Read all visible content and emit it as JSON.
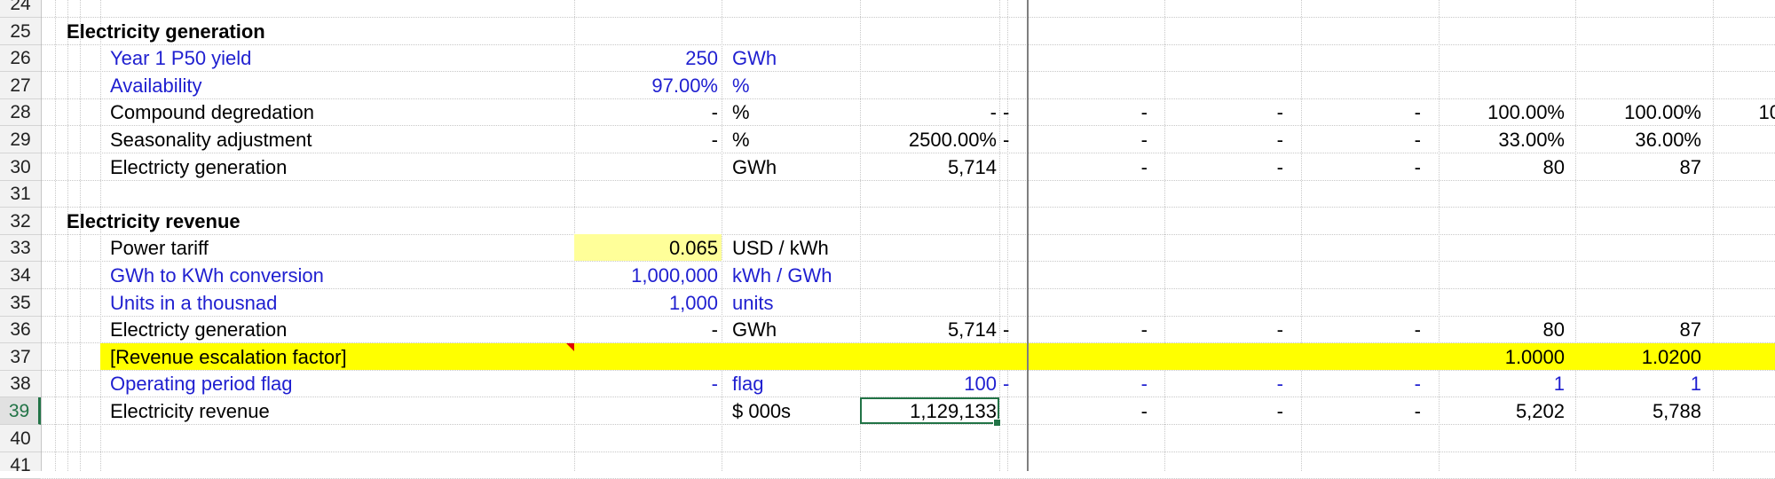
{
  "rows": [
    {
      "num": "24"
    },
    {
      "num": "25",
      "section": "Electricity generation"
    },
    {
      "num": "26",
      "label": "Year 1 P50 yield",
      "blue": true,
      "input": "250",
      "unit": "GWh",
      "total": "",
      "flag": "",
      "cols": [
        "",
        "",
        "",
        "",
        "",
        "",
        ""
      ]
    },
    {
      "num": "27",
      "label": "Availability",
      "blue": true,
      "input": "97.00%",
      "unit": "%",
      "total": "",
      "flag": "",
      "cols": [
        "",
        "",
        "",
        "",
        "",
        "",
        ""
      ]
    },
    {
      "num": "28",
      "label": "Compound degredation",
      "blue": false,
      "input": "-",
      "unit": "%",
      "total": "-",
      "flag": "-",
      "cols": [
        "-",
        "-",
        "-",
        "100.00%",
        "100.00%",
        "10"
      ]
    },
    {
      "num": "29",
      "label": "Seasonality adjustment",
      "blue": false,
      "input": "-",
      "unit": "%",
      "total": "2500.00%",
      "flag": "-",
      "cols": [
        "-",
        "-",
        "-",
        "33.00%",
        "36.00%",
        ""
      ]
    },
    {
      "num": "30",
      "label": "Electricty generation",
      "blue": false,
      "input": "",
      "unit": "GWh",
      "total": "5,714",
      "flag": "",
      "cols": [
        "-",
        "-",
        "-",
        "80",
        "87",
        ""
      ]
    },
    {
      "num": "31"
    },
    {
      "num": "32",
      "section": "Electricity revenue"
    },
    {
      "num": "33",
      "label": "Power tariff",
      "blue": false,
      "input": "0.065",
      "unit": "USD / kWh",
      "total": "",
      "flag": "",
      "cols": [
        "",
        "",
        "",
        "",
        "",
        ""
      ]
    },
    {
      "num": "34",
      "label": "GWh to KWh conversion",
      "blue": true,
      "input": "1,000,000",
      "unit": "kWh / GWh",
      "total": "",
      "flag": "",
      "cols": [
        "",
        "",
        "",
        "",
        "",
        ""
      ]
    },
    {
      "num": "35",
      "label": "Units in a thousnad",
      "blue": true,
      "input": "1,000",
      "unit": "units",
      "total": "",
      "flag": "",
      "cols": [
        "",
        "",
        "",
        "",
        "",
        ""
      ]
    },
    {
      "num": "36",
      "label": "Electricty generation",
      "blue": false,
      "input": "-",
      "unit": "GWh",
      "total": "5,714",
      "flag": "-",
      "cols": [
        "-",
        "-",
        "-",
        "80",
        "87",
        ""
      ]
    },
    {
      "num": "37",
      "label": "[Revenue escalation factor]",
      "blue": false,
      "input": "",
      "unit": "",
      "total": "",
      "flag": "",
      "cols": [
        "",
        "",
        "",
        "1.0000",
        "1.0200",
        ""
      ]
    },
    {
      "num": "38",
      "label": "Operating period flag",
      "blue": true,
      "input": "-",
      "unit": "flag",
      "total": "100",
      "flag": "-",
      "cols": [
        "-",
        "-",
        "-",
        "1",
        "1",
        ""
      ]
    },
    {
      "num": "39",
      "label": "Electricity revenue",
      "blue": false,
      "input": "",
      "unit": "$ 000s",
      "total": "1,129,133",
      "flag": "",
      "cols": [
        "-",
        "-",
        "-",
        "5,202",
        "5,788",
        ""
      ]
    },
    {
      "num": "40"
    },
    {
      "num": "41"
    }
  ],
  "colors": {
    "input_blue": "#1f1fd0",
    "highlight_yellow": "#ffff00",
    "tariff_fill": "#ffff99",
    "selection_green": "#217346"
  },
  "selected_cell_row": "39"
}
